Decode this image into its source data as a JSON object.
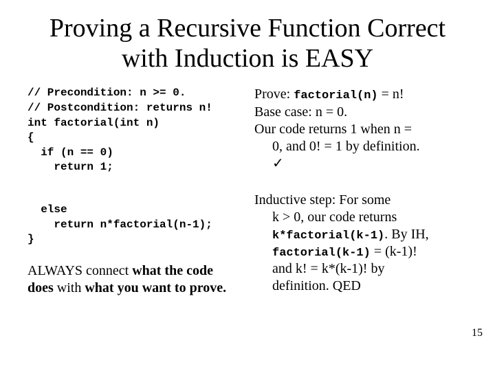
{
  "title": "Proving a Recursive Function Correct with Induction is EASY",
  "code": {
    "block1": "// Precondition: n >= 0.\n// Postcondition: returns n!\nint factorial(int n)\n{\n  if (n == 0)\n    return 1;",
    "block2": "  else\n    return n*factorial(n-1);\n}"
  },
  "note": {
    "l1": "ALWAYS connect ",
    "b1": "what the code does",
    "l2": " with ",
    "b2": "what you want to prove."
  },
  "proof": {
    "prove_pre": "Prove: ",
    "prove_mono": "factorial(n)",
    "prove_post": " = n!",
    "base": "Base case: n = 0.",
    "base2a": "Our code returns 1 when n =",
    "base2b": "0, and 0! = 1 by definition.",
    "check": "✓",
    "ind1": "Inductive step: For some",
    "ind1b": "k > 0, our code returns",
    "ind2_mono": "k*factorial(k-1)",
    "ind2_post": ". By IH,",
    "ind3_mono": "factorial(k-1)",
    "ind3_post": " = (k-1)!",
    "ind4a": "and  k! = k*(k-1)! by",
    "ind4b": "definition.  QED"
  },
  "pagenum": "15"
}
